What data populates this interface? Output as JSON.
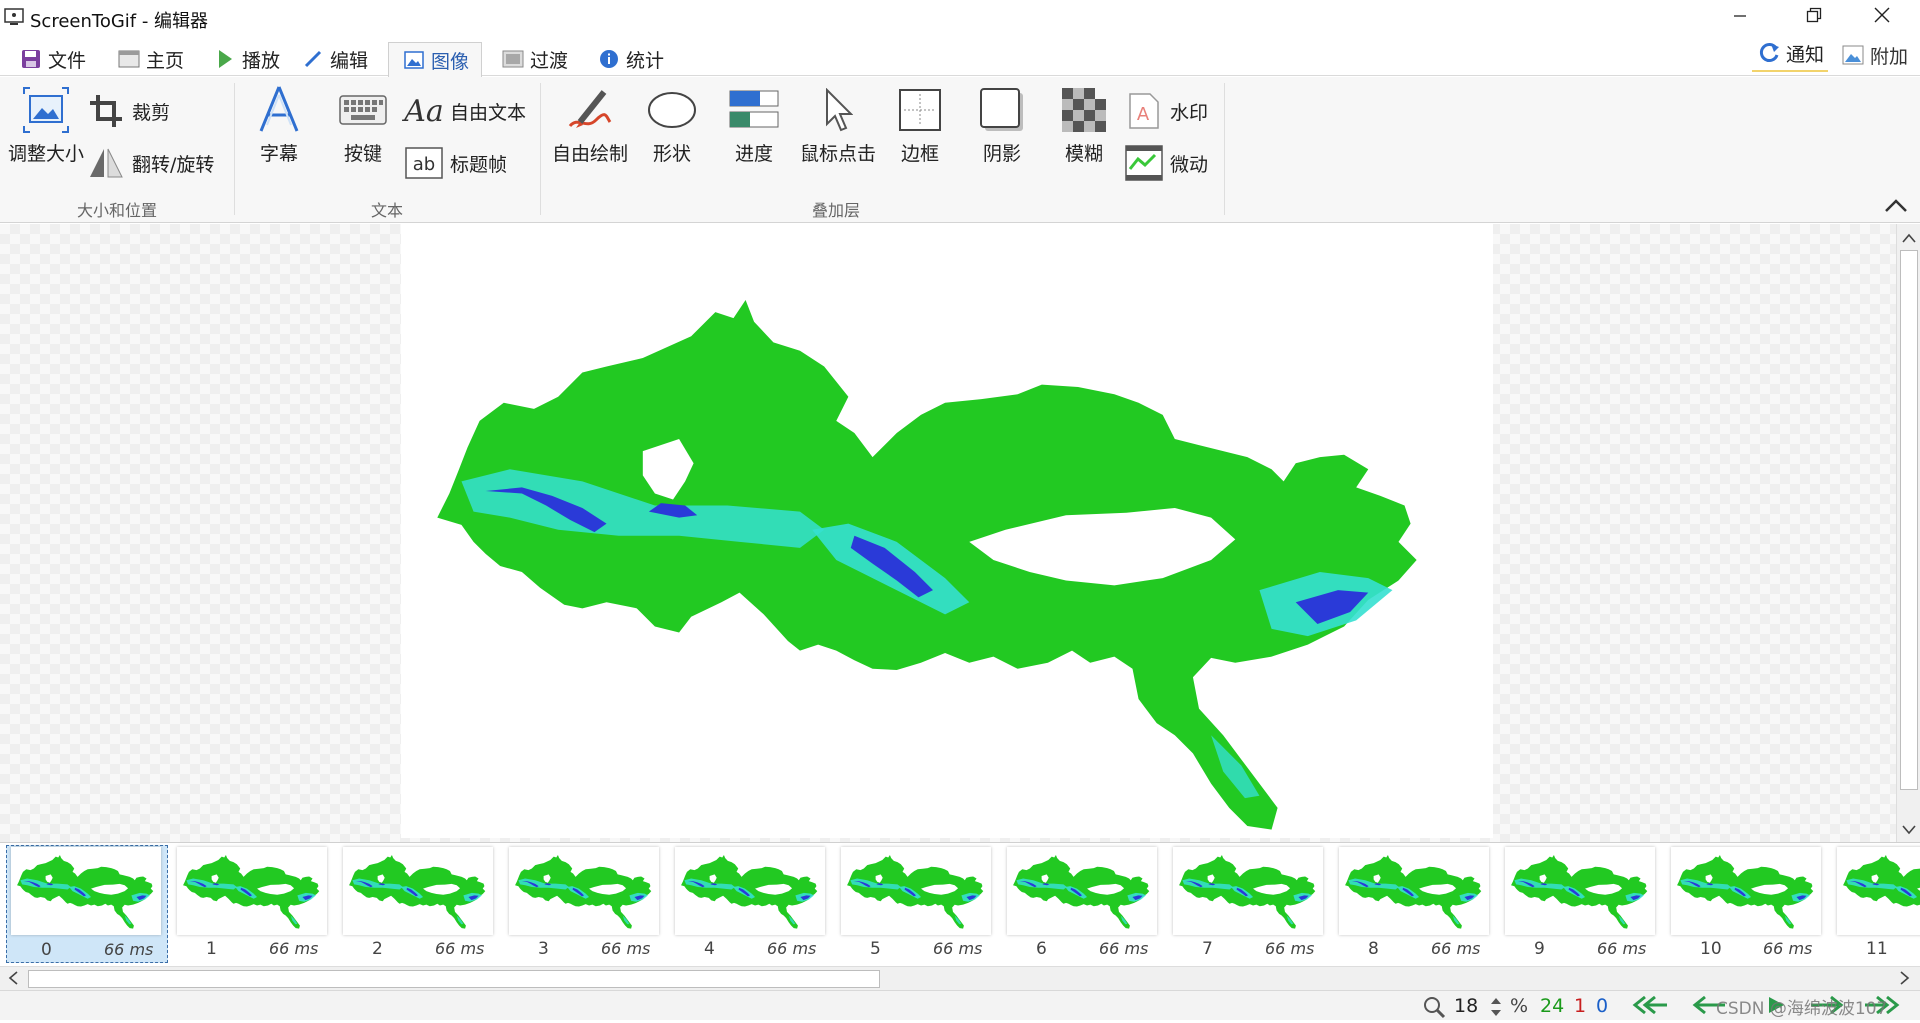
{
  "window": {
    "title": "ScreenToGif - 编辑器"
  },
  "tabs": [
    {
      "label": "文件",
      "icon": "save-icon"
    },
    {
      "label": "主页",
      "icon": "home-icon"
    },
    {
      "label": "播放",
      "icon": "play-icon"
    },
    {
      "label": "编辑",
      "icon": "pencil-icon"
    },
    {
      "label": "图像",
      "icon": "image-icon",
      "active": true
    },
    {
      "label": "过渡",
      "icon": "transition-icon"
    },
    {
      "label": "统计",
      "icon": "info-icon"
    }
  ],
  "right_buttons": {
    "notify": "通知",
    "extra": "附加"
  },
  "ribbon": {
    "size_position": {
      "label": "大小和位置",
      "resize": "调整大小",
      "crop": "裁剪",
      "flip_rotate": "翻转/旋转"
    },
    "text": {
      "label": "文本",
      "caption": "字幕",
      "key_strokes": "按键",
      "free_text": "自由文本",
      "title_frame": "标题帧"
    },
    "overlay": {
      "label": "叠加层",
      "free_drawing": "自由绘制",
      "shape": "形状",
      "progress": "进度",
      "mouse_clicks": "鼠标点击",
      "border": "边框",
      "shadow": "阴影",
      "blur": "模糊",
      "watermark": "水印",
      "cinemagraph": "微动"
    }
  },
  "frames": [
    {
      "index": "0",
      "duration": "66 ms",
      "selected": true
    },
    {
      "index": "1",
      "duration": "66 ms"
    },
    {
      "index": "2",
      "duration": "66 ms"
    },
    {
      "index": "3",
      "duration": "66 ms"
    },
    {
      "index": "4",
      "duration": "66 ms"
    },
    {
      "index": "5",
      "duration": "66 ms"
    },
    {
      "index": "6",
      "duration": "66 ms"
    },
    {
      "index": "7",
      "duration": "66 ms"
    },
    {
      "index": "8",
      "duration": "66 ms"
    },
    {
      "index": "9",
      "duration": "66 ms"
    },
    {
      "index": "10",
      "duration": "66 ms"
    },
    {
      "index": "11",
      "duration": ""
    }
  ],
  "status": {
    "zoom": "18",
    "zoom_unit": "%",
    "frame_count": "24",
    "selected_count": "1",
    "current_index": "0",
    "watermark_text": "CSDN @海绵波波107"
  },
  "colors": {
    "map_green": "#22c922",
    "map_cyan": "#35e0d0",
    "map_blue": "#2a3ad8",
    "count_green": "#1a9a1a",
    "count_red": "#c81e1e",
    "count_blue": "#1a5fc8"
  }
}
